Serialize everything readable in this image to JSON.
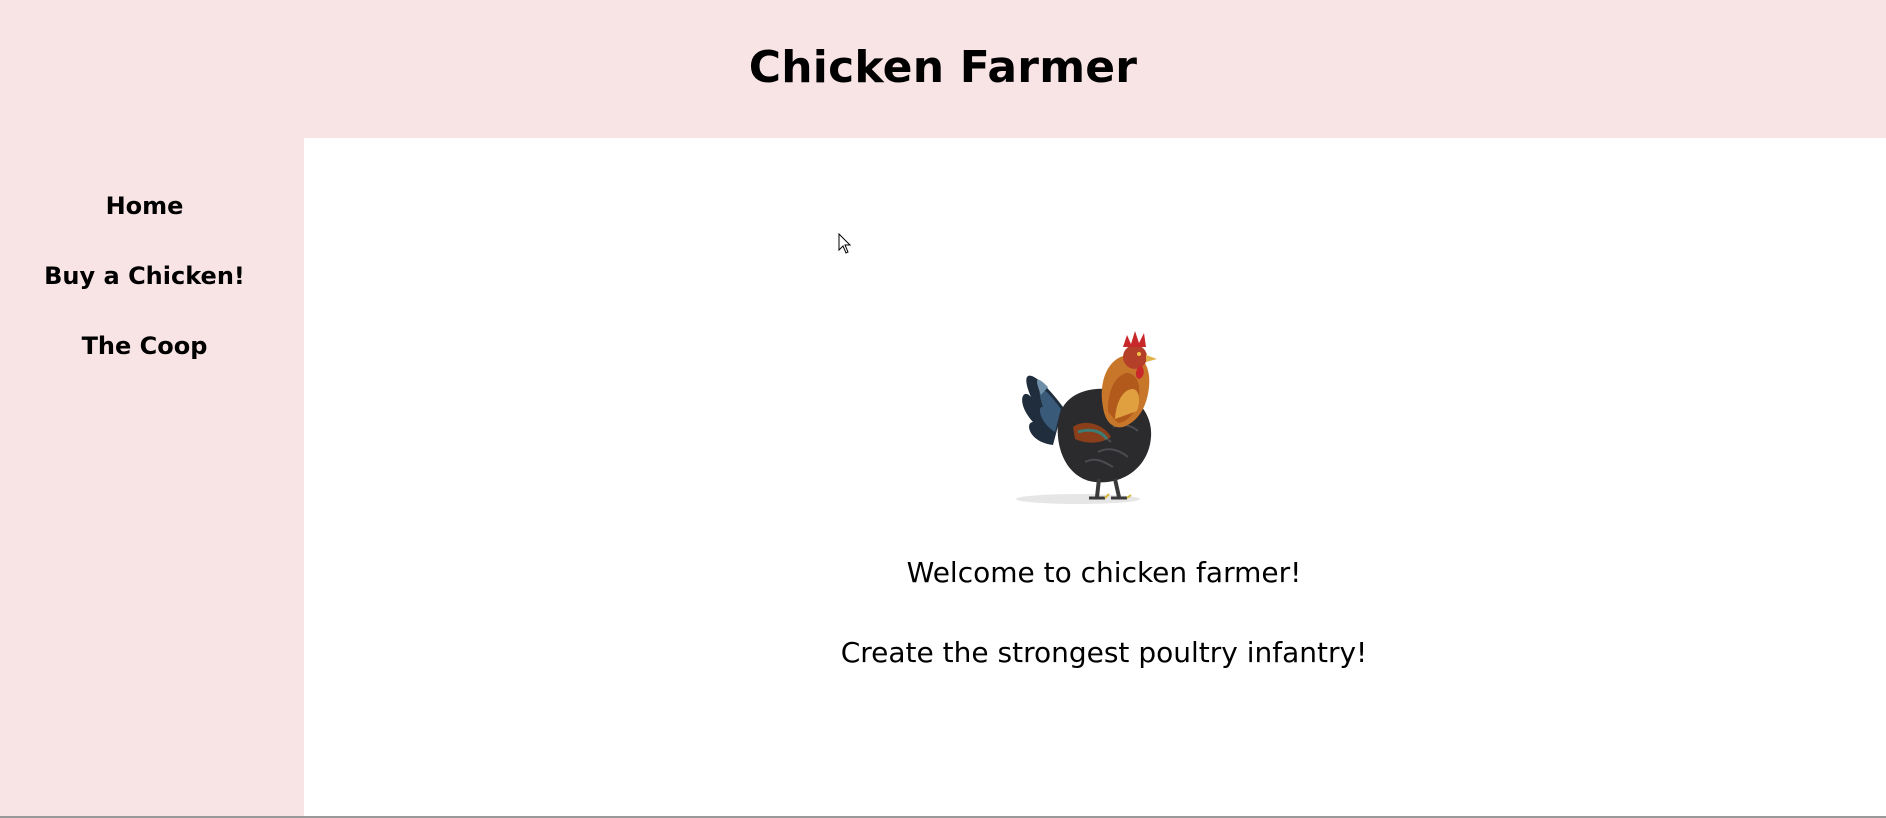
{
  "header": {
    "title": "Chicken Farmer"
  },
  "sidebar": {
    "items": [
      {
        "label": "Home"
      },
      {
        "label": "Buy a Chicken!"
      },
      {
        "label": "The Coop"
      }
    ]
  },
  "main": {
    "hero_image": "rooster-image",
    "welcome_line": "Welcome to chicken farmer!",
    "tagline": "Create the strongest poultry infantry!"
  },
  "colors": {
    "page_background": "#f8e4e4",
    "content_background": "#ffffff"
  },
  "icons": {
    "cursor": "mouse-pointer-icon"
  }
}
